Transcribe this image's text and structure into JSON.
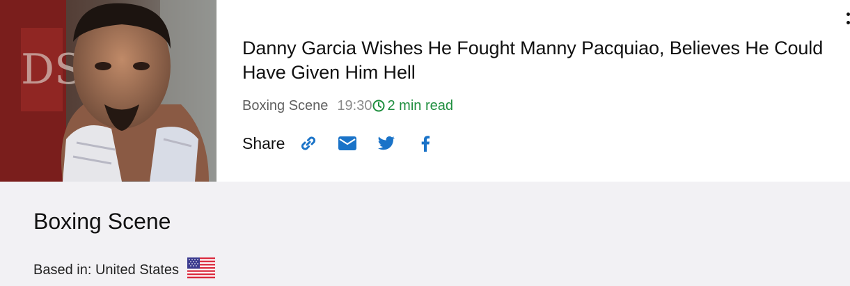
{
  "article": {
    "title": "Danny Garcia Wishes He Fought Manny Pacquiao, Believes He Could Have Given Him Hell",
    "source": "Boxing Scene",
    "time": "19:30",
    "read_time": "2 min read",
    "share_label": "Share",
    "share_icons": [
      "link-icon",
      "envelope-icon",
      "twitter-icon",
      "facebook-icon"
    ]
  },
  "source_panel": {
    "name": "Boxing Scene",
    "based_in": "Based in: United States",
    "flag_icon": "us-flag-icon"
  },
  "colors": {
    "accent_blue": "#1a73c8",
    "read_green": "#1e8e3e",
    "panel_bg": "#f2f1f4"
  }
}
